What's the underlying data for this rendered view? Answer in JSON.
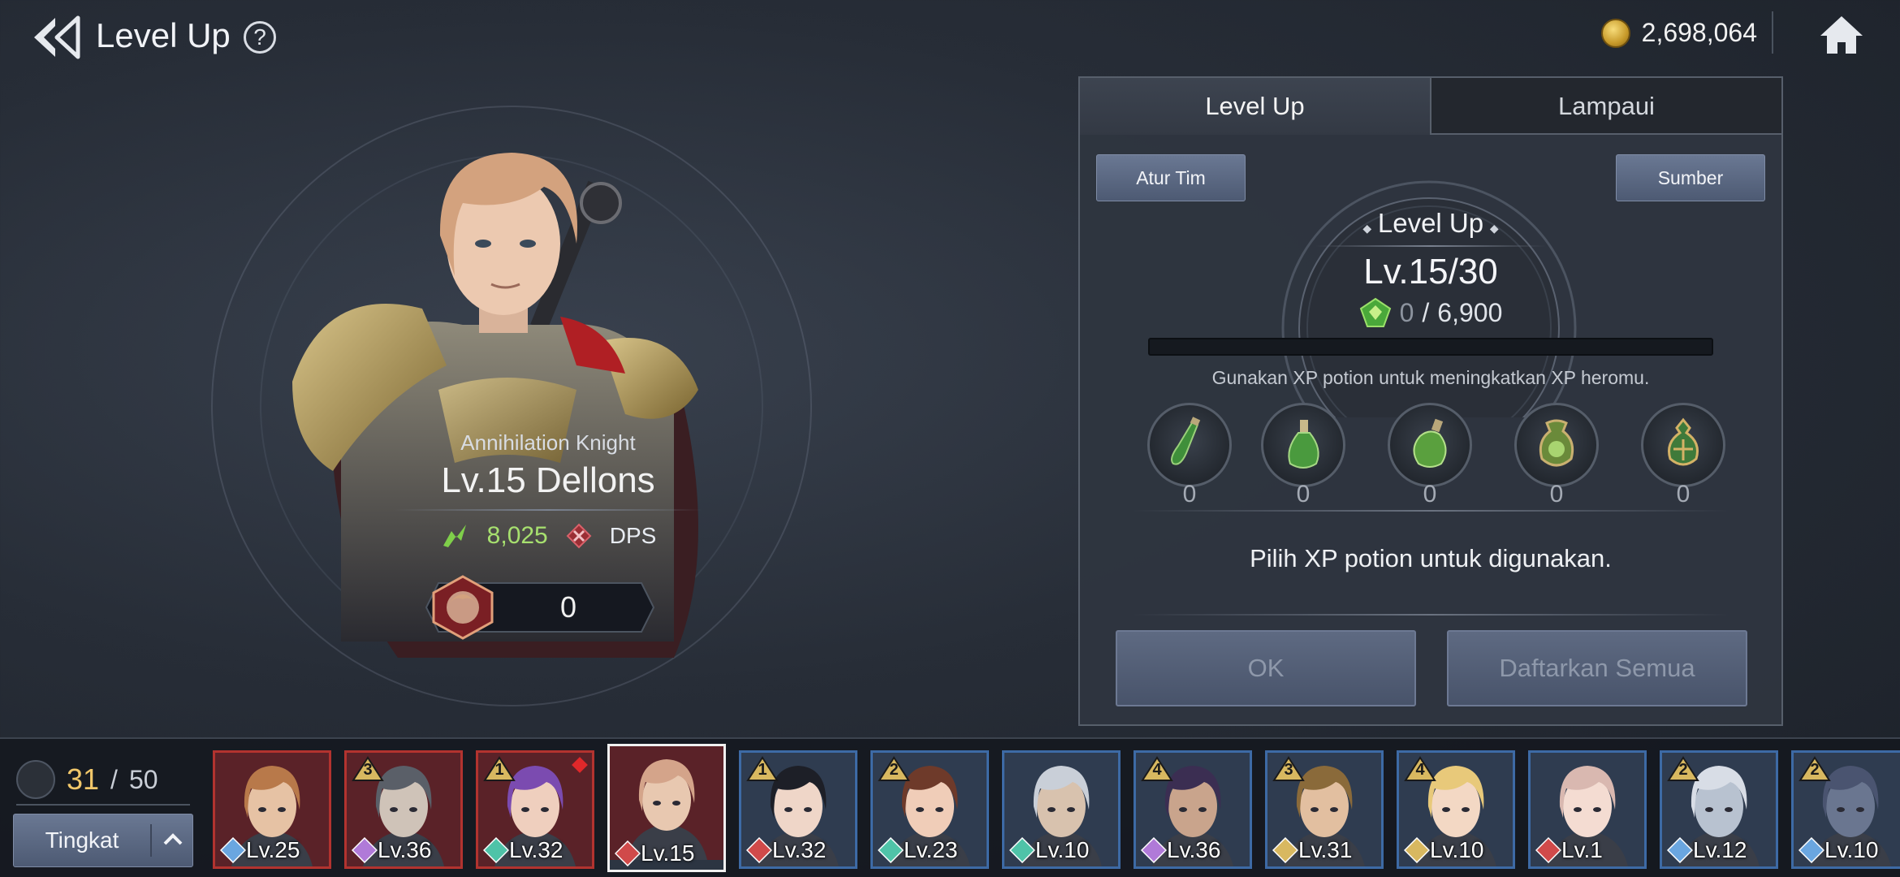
{
  "header": {
    "title": "Level Up",
    "help_glyph": "?",
    "gold": "2,698,064"
  },
  "hero": {
    "class_name": "Annihilation Knight",
    "level_text": "Lv.15",
    "name": "Dellons",
    "power": "8,025",
    "role": "DPS",
    "limit_break_count": "0"
  },
  "panel": {
    "tabs": [
      {
        "label": "Level Up",
        "active": true
      },
      {
        "label": "Lampaui",
        "active": false
      }
    ],
    "team_button": "Atur Tim",
    "source_button": "Sumber",
    "level_label": "Level Up",
    "level_value": "Lv.15/30",
    "xp_current": "0",
    "xp_slash": "/",
    "xp_max": "6,900",
    "xp_progress": 0,
    "hint": "Gunakan XP potion untuk meningkatkan XP heromu.",
    "potions": [
      {
        "name": "small-xp-potion",
        "count": "0"
      },
      {
        "name": "medium-xp-potion",
        "count": "0"
      },
      {
        "name": "large-xp-potion",
        "count": "0"
      },
      {
        "name": "huge-xp-potion",
        "count": "0"
      },
      {
        "name": "supreme-xp-potion",
        "count": "0"
      }
    ],
    "choose_text": "Pilih XP potion untuk digunakan.",
    "ok_button": "OK",
    "register_all_button": "Daftarkan Semua"
  },
  "roster": {
    "slots_current": "31",
    "slots_sep": "/",
    "slots_max": "50",
    "sort_label": "Tingkat",
    "heroes": [
      {
        "level": "Lv.25",
        "class": "tank",
        "tier": "",
        "frame": "red",
        "hair": "#b8794a",
        "skin": "#e6c2a4",
        "selected": false,
        "gem": false
      },
      {
        "level": "Lv.36",
        "class": "mage",
        "tier": "3",
        "frame": "red",
        "hair": "#5a5f68",
        "skin": "#cfc3b8",
        "selected": false,
        "gem": false
      },
      {
        "level": "Lv.32",
        "class": "support",
        "tier": "1",
        "frame": "red",
        "hair": "#7b4bb0",
        "skin": "#efcfbe",
        "selected": false,
        "gem": true
      },
      {
        "level": "Lv.15",
        "class": "dps",
        "tier": "",
        "frame": "red",
        "hair": "#d4a48a",
        "skin": "#e8c8b0",
        "selected": true,
        "gem": false
      },
      {
        "level": "Lv.32",
        "class": "dps",
        "tier": "1",
        "frame": "blue",
        "hair": "#1d1f27",
        "skin": "#efd6c8",
        "selected": false,
        "gem": false
      },
      {
        "level": "Lv.23",
        "class": "support",
        "tier": "2",
        "frame": "blue",
        "hair": "#6e3a2a",
        "skin": "#f0cdb8",
        "selected": false,
        "gem": false
      },
      {
        "level": "Lv.10",
        "class": "support",
        "tier": "",
        "frame": "blue",
        "hair": "#c9cfd8",
        "skin": "#d8c2ae",
        "selected": false,
        "gem": false
      },
      {
        "level": "Lv.36",
        "class": "mage",
        "tier": "4",
        "frame": "blue",
        "hair": "#3b2e52",
        "skin": "#c9a48c",
        "selected": false,
        "gem": false
      },
      {
        "level": "Lv.31",
        "class": "ranger",
        "tier": "3",
        "frame": "blue",
        "hair": "#8a6a3a",
        "skin": "#e2bfa0",
        "selected": false,
        "gem": false
      },
      {
        "level": "Lv.10",
        "class": "ranger",
        "tier": "4",
        "frame": "blue",
        "hair": "#e8c97a",
        "skin": "#f3d8c4",
        "selected": false,
        "gem": false
      },
      {
        "level": "Lv.1",
        "class": "dps",
        "tier": "",
        "frame": "blue",
        "hair": "#d9b8b0",
        "skin": "#f4dcd2",
        "selected": false,
        "gem": false
      },
      {
        "level": "Lv.12",
        "class": "tank",
        "tier": "2",
        "frame": "blue",
        "hair": "#d8dde6",
        "skin": "#b8c2d0",
        "selected": false,
        "gem": false
      },
      {
        "level": "Lv.10",
        "class": "tank",
        "tier": "2",
        "frame": "blue",
        "hair": "#4a5470",
        "skin": "#6a7690",
        "selected": false,
        "gem": false
      }
    ]
  },
  "colors": {
    "accent_button": "#5a6780",
    "power_green": "#a7e06f",
    "slots_gold": "#f1c76a",
    "red_frame": "#b2332f",
    "blue_frame": "#3d6aa5",
    "class_tank": "#6aa6e0",
    "class_mage": "#b07ad8",
    "class_support": "#4fc3a8",
    "class_dps": "#d04a4a",
    "class_ranger": "#d8b860"
  }
}
